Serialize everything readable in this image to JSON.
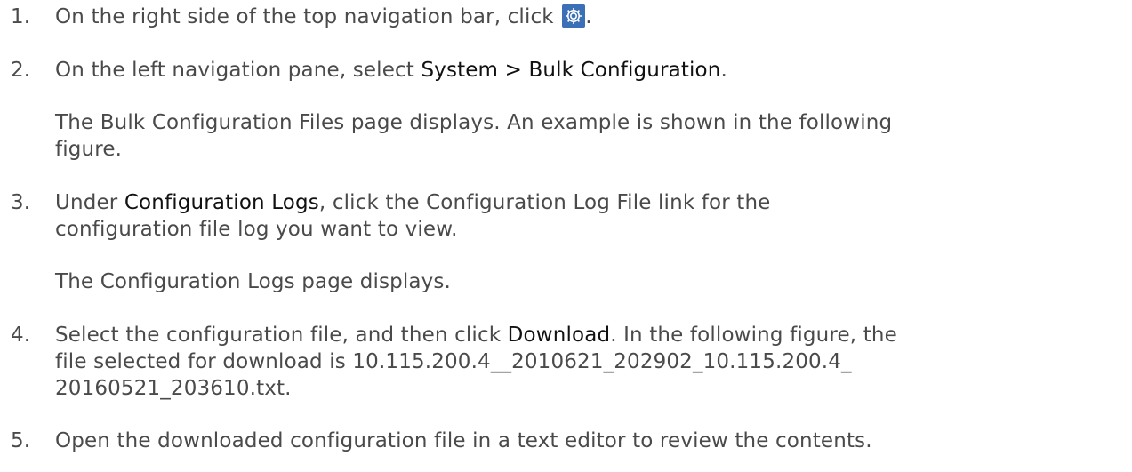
{
  "steps": [
    {
      "num": "1.",
      "pre": "On the right side of the top navigation bar, click",
      "icon": "gear-icon",
      "post": "."
    },
    {
      "num": "2.",
      "pre": "On the left navigation pane, select ",
      "bold": "System > Bulk Configuration",
      "post": ".",
      "note_line1": "The Bulk Configuration Files page displays. An example is shown in the following",
      "note_line2": "figure."
    },
    {
      "num": "3.",
      "pre": "Under ",
      "bold": "Configuration Logs",
      "post": ", click the Configuration Log File link for the",
      "line2": "configuration file log you want to view.",
      "note": "The Configuration Logs page displays."
    },
    {
      "num": "4.",
      "pre": "Select the configuration file, and then click ",
      "bold": "Download",
      "post": ". In the following figure, the",
      "line2": "file selected for download is 10.115.200.4__2010621_202902_10.115.200.4_",
      "line3": "20160521_203610.txt."
    },
    {
      "num": "5.",
      "text": "Open the downloaded configuration file in a text editor to review the contents."
    }
  ],
  "colors": {
    "body_text": "#4a4a4a",
    "bold_text": "#111111",
    "gear_bg": "#3b6fb6"
  }
}
